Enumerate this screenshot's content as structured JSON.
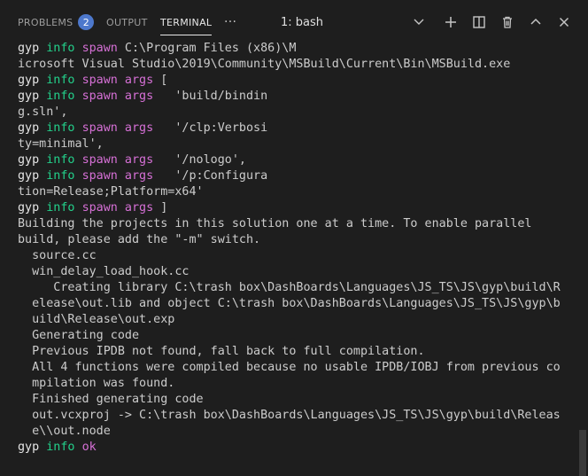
{
  "tabs": {
    "problems": {
      "label": "PROBLEMS",
      "badge": "2"
    },
    "output": {
      "label": "OUTPUT"
    },
    "terminal": {
      "label": "TERMINAL"
    },
    "more": "···"
  },
  "terminal_select": {
    "value": "1: bash"
  },
  "actions": {
    "new_terminal": "plus-icon",
    "split": "split-icon",
    "kill": "trash-icon",
    "maximize": "chevron-up-icon",
    "close": "close-icon"
  },
  "log_lines": [
    [
      {
        "t": "gyp",
        "c": "gyp"
      },
      {
        "t": " "
      },
      {
        "t": "info",
        "c": "info"
      },
      {
        "t": " "
      },
      {
        "t": "spawn",
        "c": "spawn"
      },
      {
        "t": " C:\\Program Files (x86)\\M"
      }
    ],
    [
      {
        "t": "icrosoft Visual Studio\\2019\\Community\\MSBuild\\Current\\Bin\\MSBuild.exe"
      }
    ],
    [
      {
        "t": "gyp",
        "c": "gyp"
      },
      {
        "t": " "
      },
      {
        "t": "info",
        "c": "info"
      },
      {
        "t": " "
      },
      {
        "t": "spawn args",
        "c": "args"
      },
      {
        "t": " ["
      }
    ],
    [
      {
        "t": "gyp",
        "c": "gyp"
      },
      {
        "t": " "
      },
      {
        "t": "info",
        "c": "info"
      },
      {
        "t": " "
      },
      {
        "t": "spawn args",
        "c": "args"
      },
      {
        "t": "   'build/bindin"
      }
    ],
    [
      {
        "t": "g.sln',"
      }
    ],
    [
      {
        "t": "gyp",
        "c": "gyp"
      },
      {
        "t": " "
      },
      {
        "t": "info",
        "c": "info"
      },
      {
        "t": " "
      },
      {
        "t": "spawn args",
        "c": "args"
      },
      {
        "t": "   '/clp:Verbosi"
      }
    ],
    [
      {
        "t": "ty=minimal',"
      }
    ],
    [
      {
        "t": "gyp",
        "c": "gyp"
      },
      {
        "t": " "
      },
      {
        "t": "info",
        "c": "info"
      },
      {
        "t": " "
      },
      {
        "t": "spawn args",
        "c": "args"
      },
      {
        "t": "   '/nologo',"
      }
    ],
    [
      {
        "t": "gyp",
        "c": "gyp"
      },
      {
        "t": " "
      },
      {
        "t": "info",
        "c": "info"
      },
      {
        "t": " "
      },
      {
        "t": "spawn args",
        "c": "args"
      },
      {
        "t": "   '/p:Configura"
      }
    ],
    [
      {
        "t": "tion=Release;Platform=x64'"
      }
    ],
    [
      {
        "t": "gyp",
        "c": "gyp"
      },
      {
        "t": " "
      },
      {
        "t": "info",
        "c": "info"
      },
      {
        "t": " "
      },
      {
        "t": "spawn args",
        "c": "args"
      },
      {
        "t": " ]"
      }
    ],
    [
      {
        "t": "Building the projects in this solution one at a time. To enable parallel"
      }
    ],
    [
      {
        "t": "build, please add the \"-m\" switch."
      }
    ],
    [
      {
        "t": "  source.cc"
      }
    ],
    [
      {
        "t": "  win_delay_load_hook.cc"
      }
    ],
    [
      {
        "t": "     Creating library C:\\trash box\\DashBoards\\Languages\\JS_TS\\JS\\gyp\\build\\R"
      }
    ],
    [
      {
        "t": "  elease\\out.lib and object C:\\trash box\\DashBoards\\Languages\\JS_TS\\JS\\gyp\\b"
      }
    ],
    [
      {
        "t": "  uild\\Release\\out.exp"
      }
    ],
    [
      {
        "t": "  Generating code"
      }
    ],
    [
      {
        "t": "  Previous IPDB not found, fall back to full compilation."
      }
    ],
    [
      {
        "t": "  All 4 functions were compiled because no usable IPDB/IOBJ from previous co"
      }
    ],
    [
      {
        "t": "  mpilation was found."
      }
    ],
    [
      {
        "t": "  Finished generating code"
      }
    ],
    [
      {
        "t": "  out.vcxproj -> C:\\trash box\\DashBoards\\Languages\\JS_TS\\JS\\gyp\\build\\Releas"
      }
    ],
    [
      {
        "t": "  e\\\\out.node"
      }
    ],
    [
      {
        "t": "gyp",
        "c": "gyp"
      },
      {
        "t": " "
      },
      {
        "t": "info",
        "c": "info"
      },
      {
        "t": " "
      },
      {
        "t": "ok",
        "c": "ok"
      },
      {
        "t": " "
      }
    ]
  ],
  "colors": {
    "background": "#1e1e1e",
    "info": "#23d18b",
    "spawn": "#d670d6",
    "badge": "#4d78cc"
  }
}
